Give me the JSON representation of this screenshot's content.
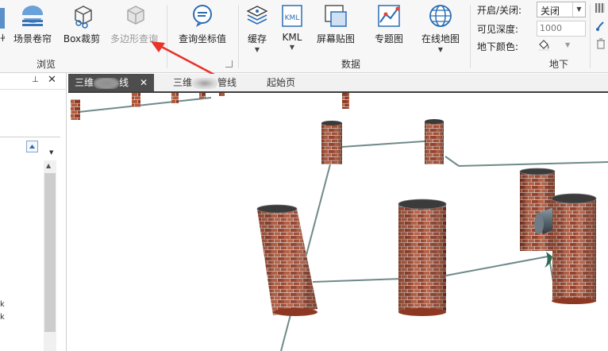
{
  "ribbon": {
    "browse": {
      "group_label": "浏览",
      "buttons": [
        {
          "id": "scene-roll",
          "label": "场景卷帘"
        },
        {
          "id": "box-clip",
          "label": "Box裁剪"
        },
        {
          "id": "polygon-query",
          "label": "多边形查询"
        }
      ]
    },
    "query_coord": {
      "label": "查询坐标值"
    },
    "data": {
      "group_label": "数据",
      "buttons": [
        {
          "id": "cache",
          "label": "缓存"
        },
        {
          "id": "kml",
          "label": "KML"
        },
        {
          "id": "screen-paste",
          "label": "屏幕贴图"
        },
        {
          "id": "thematic-map",
          "label": "专题图"
        },
        {
          "id": "online-map",
          "label": "在线地图"
        }
      ]
    },
    "underground": {
      "group_label": "地下",
      "toggle_label": "开启/关闭:",
      "toggle_value": "关闭",
      "depth_label": "可见深度:",
      "depth_placeholder": "1000",
      "color_label": "地下颜色:"
    },
    "kml_icon_text": "KML"
  },
  "left_panel": {
    "letters": [
      "k",
      "k"
    ]
  },
  "tabs": [
    {
      "id": "tab-1",
      "label_start": "三维",
      "label_end": "线",
      "active": true
    },
    {
      "id": "tab-2",
      "label_start": "三维",
      "label_end": "管线",
      "active": false
    },
    {
      "id": "tab-3",
      "label": "起始页",
      "active": false
    }
  ],
  "colors": {
    "accent_red_arrow": "#e8322a",
    "tab_active": "#4d4d4d",
    "brick": "#a0422c",
    "pipe": "#6f8a88"
  }
}
